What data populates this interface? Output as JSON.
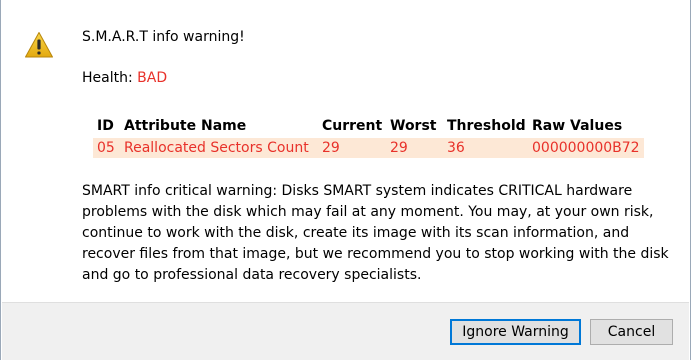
{
  "dialog": {
    "title": "S.M.A.R.T info warning!",
    "health_label": "Health: ",
    "health_value": "BAD"
  },
  "table": {
    "headers": [
      "ID",
      "Attribute Name",
      "Current",
      "Worst",
      "Threshold",
      "Raw Values"
    ],
    "rows": [
      [
        "05",
        "Reallocated Sectors Count",
        "29",
        "29",
        "36",
        "000000000B72"
      ]
    ]
  },
  "message": "SMART info critical warning: Disks SMART system indicates CRITICAL hardware problems with the disk which may fail at any moment. You may, at your own risk, continue to work with the disk, create its image with its scan information, and recover files from that image, but we recommend you to stop working with the disk and go to professional data recovery specialists.",
  "buttons": {
    "ignore_label": "Ignore Warning",
    "cancel_label": "Cancel"
  },
  "icons": {
    "warning": "warning-triangle-icon"
  },
  "colors": {
    "bad": "#e8312a",
    "row_highlight": "#fde8d6",
    "warning_icon": "#f2c01e",
    "primary_border": "#0078d7"
  }
}
